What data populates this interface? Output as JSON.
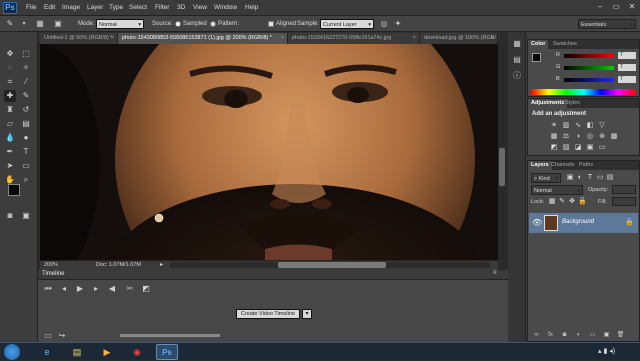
{
  "app": {
    "logo": "Ps"
  },
  "menu": [
    "File",
    "Edit",
    "Image",
    "Layer",
    "Type",
    "Select",
    "Filter",
    "3D",
    "View",
    "Window",
    "Help"
  ],
  "options": {
    "mode_label": "Mode:",
    "mode_value": "Normal",
    "source_label": "Source:",
    "sampled_label": "Sampled",
    "pattern_label": "Pattern:",
    "aligned_label": "Aligned",
    "sample_label": "Sample:",
    "sample_value": "Current Layer",
    "workspace": "Essentials"
  },
  "tabs": [
    {
      "label": "Untitled-1 @ 50% (RGB/8) *"
    },
    {
      "label": "photo-1543080853-556086153871 (1).jpg @ 200% (RGB/8) *"
    },
    {
      "label": "photo-1529416227270-05ffe151a74c.jpg"
    },
    {
      "label": "download.jpg @ 100% (RGB/"
    }
  ],
  "status": {
    "zoom": "200%",
    "doc": "Doc: 1.07M/1.07M"
  },
  "timeline": {
    "title": "Timeline",
    "create_button": "Create Video Timeline"
  },
  "color_panel": {
    "tabs": [
      "Color",
      "Swatches"
    ],
    "r_label": "R",
    "r_value": "7",
    "g_label": "G",
    "g_value": "7",
    "b_label": "B",
    "b_value": "7"
  },
  "adjustments_panel": {
    "tabs": [
      "Adjustments",
      "Styles"
    ],
    "heading": "Add an adjustment"
  },
  "layers_panel": {
    "tabs": [
      "Layers",
      "Channels",
      "Paths"
    ],
    "kind_label": "Kind",
    "blend_mode": "Normal",
    "opacity_label": "Opacity:",
    "lock_label": "Lock:",
    "fill_label": "Fill:",
    "layer_name": "Background"
  },
  "colors": {
    "accent": "#2e6db4",
    "selected_layer": "#5d7899",
    "canvas_bg": "#141010"
  },
  "icons": [
    "brush-icon",
    "move-icon",
    "marquee-icon",
    "lasso-icon",
    "quick-select-icon",
    "crop-icon",
    "eyedropper-icon",
    "healing-icon",
    "clone-stamp-icon",
    "history-brush-icon",
    "eraser-icon",
    "gradient-icon",
    "blur-icon",
    "dodge-icon",
    "pen-icon",
    "type-icon",
    "path-select-icon",
    "shape-icon",
    "hand-icon",
    "zoom-icon"
  ]
}
